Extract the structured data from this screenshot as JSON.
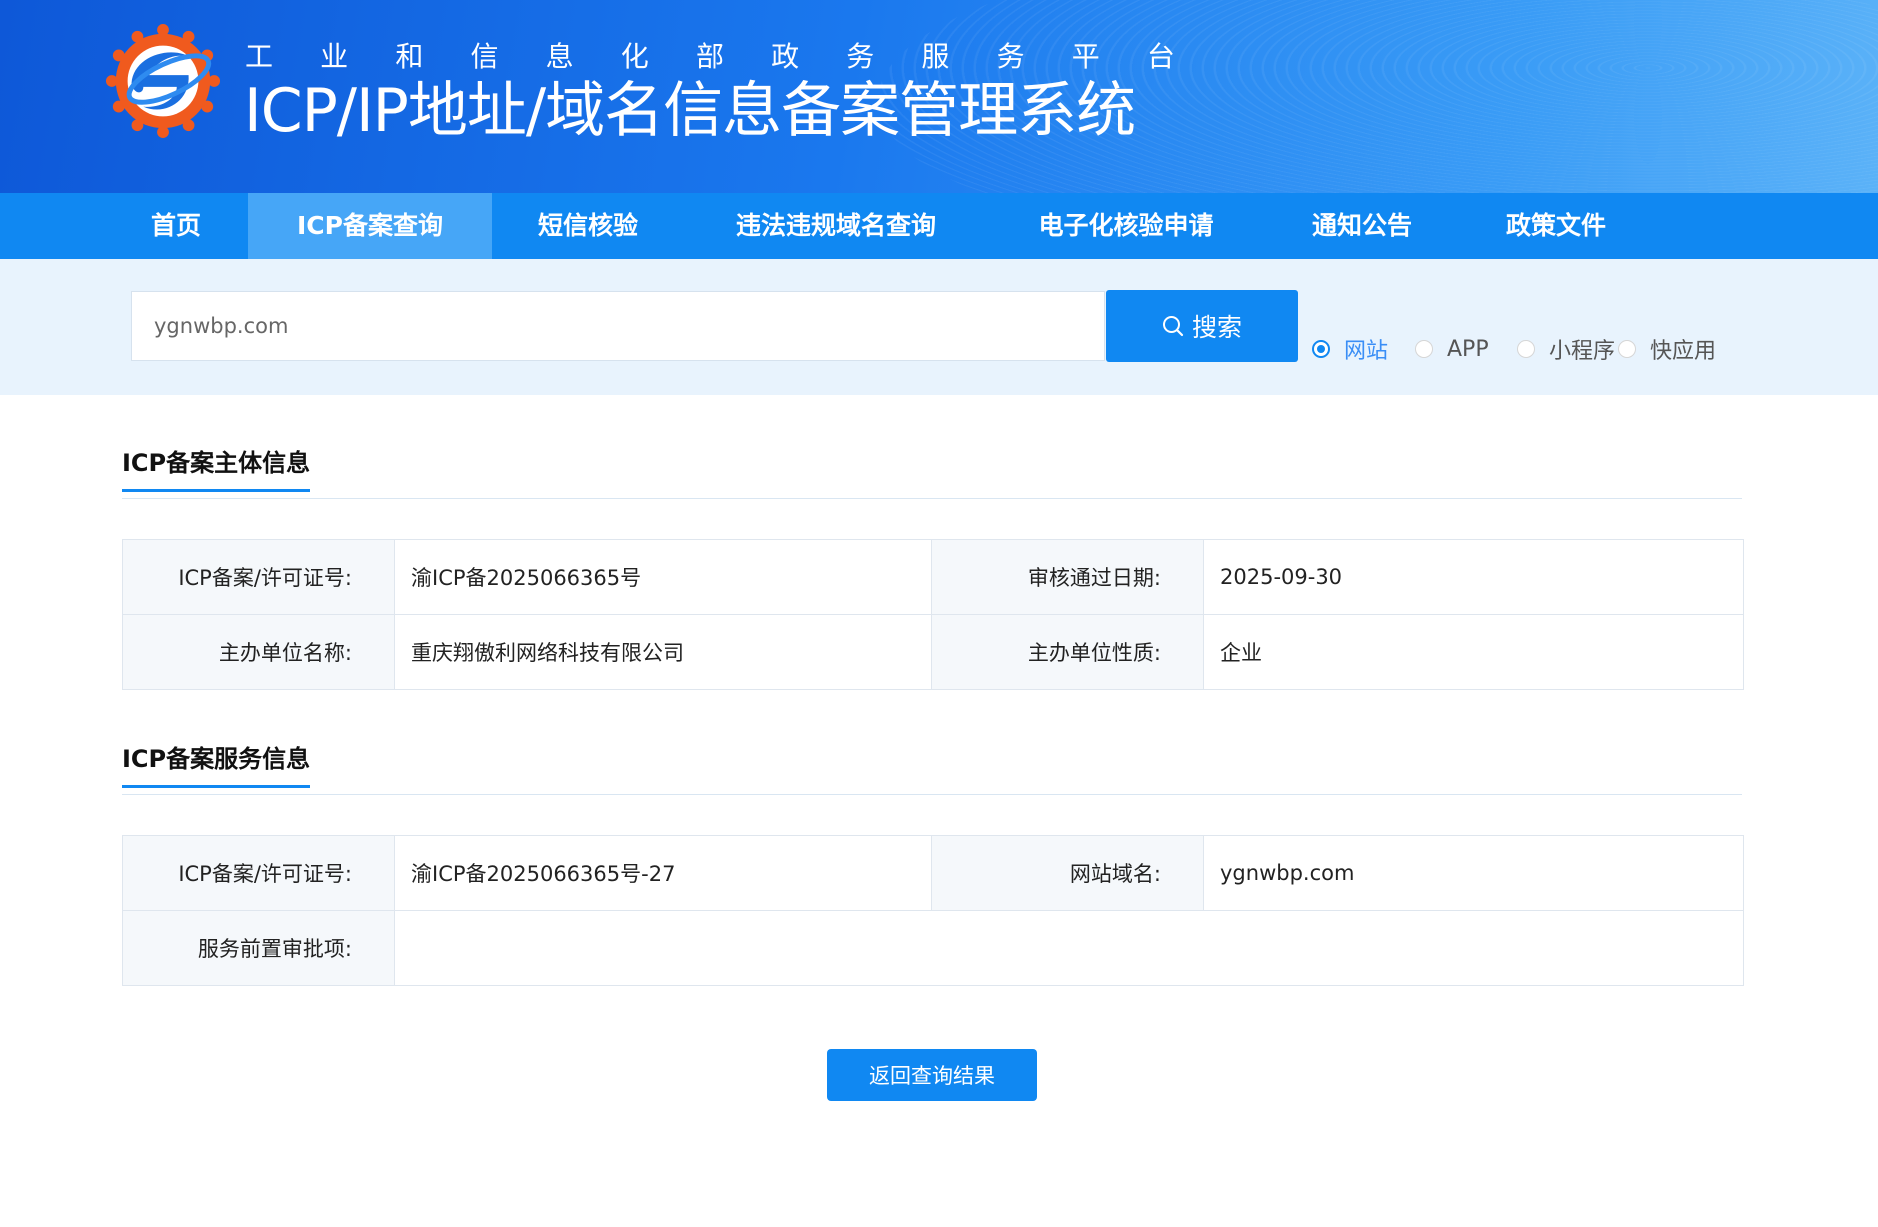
{
  "header": {
    "subtitle_chars": [
      "工",
      "业",
      "和",
      "信",
      "息",
      "化",
      "部",
      "政",
      "务",
      "服",
      "务",
      "平",
      "台"
    ],
    "title": "ICP/IP地址/域名信息备案管理系统"
  },
  "nav": {
    "items": [
      {
        "label": "首页",
        "active": false
      },
      {
        "label": "ICP备案查询",
        "active": true
      },
      {
        "label": "短信核验",
        "active": false
      },
      {
        "label": "违法违规域名查询",
        "active": false
      },
      {
        "label": "电子化核验申请",
        "active": false
      },
      {
        "label": "通知公告",
        "active": false
      },
      {
        "label": "政策文件",
        "active": false
      }
    ]
  },
  "search": {
    "value": "ygnwbp.com",
    "button_label": "搜索",
    "types": [
      {
        "label": "网站",
        "checked": true
      },
      {
        "label": "APP",
        "checked": false
      },
      {
        "label": "小程序",
        "checked": false
      },
      {
        "label": "快应用",
        "checked": false
      }
    ]
  },
  "subject_section": {
    "title": "ICP备案主体信息",
    "license_label": "ICP备案/许可证号:",
    "license_value": "渝ICP备2025066365号",
    "approve_label": "审核通过日期:",
    "approve_value": "2025-09-30",
    "org_label": "主办单位名称:",
    "org_value": "重庆翔傲利网络科技有限公司",
    "nature_label": "主办单位性质:",
    "nature_value": "企业"
  },
  "service_section": {
    "title": "ICP备案服务信息",
    "license_label": "ICP备案/许可证号:",
    "license_value": "渝ICP备2025066365号-27",
    "domain_label": "网站域名:",
    "domain_value": "ygnwbp.com",
    "preapproval_label": "服务前置审批项:",
    "preapproval_value": ""
  },
  "back_button_label": "返回查询结果",
  "colors": {
    "primary": "#1088f2",
    "nav_active": "#46a6f7",
    "search_strip": "#e8f3fd",
    "logo_orange": "#f05a1e"
  }
}
